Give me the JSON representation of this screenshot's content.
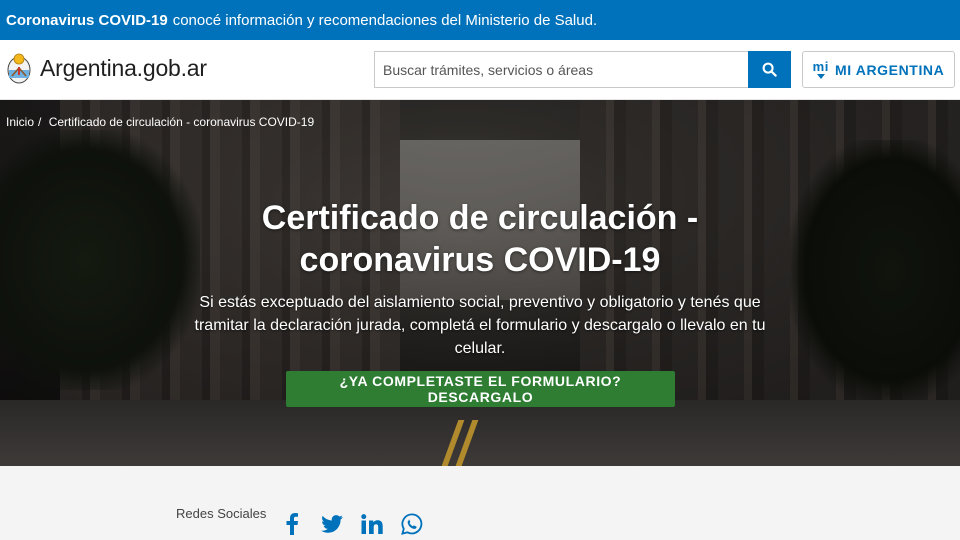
{
  "alert": {
    "strong": "Coronavirus COVID-19",
    "text": "conocé información y recomendaciones del Ministerio de Salud."
  },
  "header": {
    "logo_text": "Argentina.gob.ar",
    "search": {
      "placeholder": "Buscar trámites, servicios o áreas",
      "icon": "search-icon"
    },
    "mi_argentina": {
      "logo": "mi",
      "label": "MI ARGENTINA"
    }
  },
  "breadcrumb": {
    "home": "Inicio",
    "separator": "/",
    "current": "Certificado de circulación - coronavirus COVID-19"
  },
  "hero": {
    "title_line1": "Certificado de circulación -",
    "title_line2": "coronavirus COVID-19",
    "description": "Si estás exceptuado del aislamiento social, preventivo y obligatorio y tenés que tramitar la declaración jurada, completá el formulario y descargalo o llevalo en tu celular.",
    "cta": "¿YA COMPLETASTE EL FORMULARIO? DESCARGALO"
  },
  "social": {
    "label": "Redes Sociales",
    "icons": [
      "facebook-icon",
      "twitter-icon",
      "linkedin-icon",
      "whatsapp-icon"
    ]
  },
  "colors": {
    "primary_blue": "#0072bb",
    "cta_green": "#2e7d33",
    "band_gray": "#f4f4f4"
  }
}
